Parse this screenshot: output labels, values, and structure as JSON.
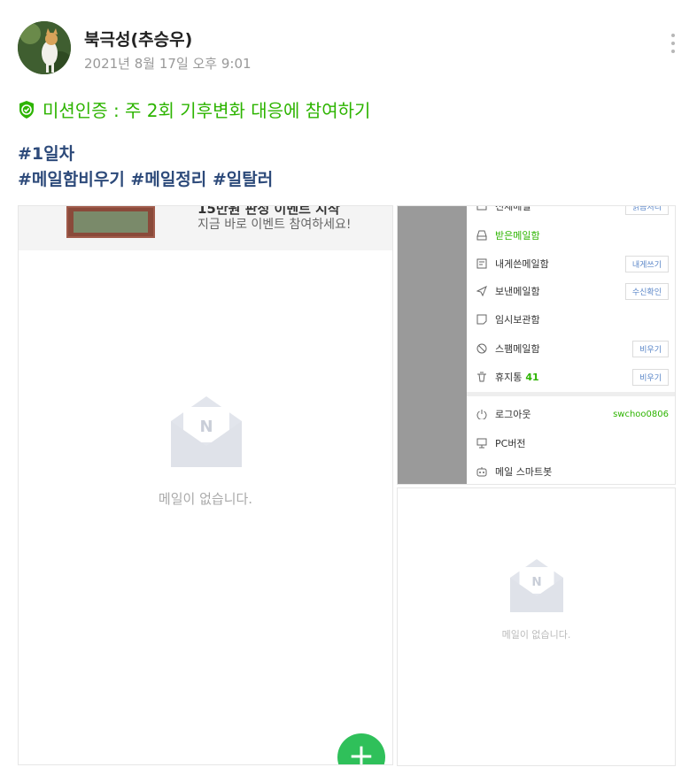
{
  "post": {
    "author": "북극성(추승우)",
    "timestamp": "2021년 8월 17일 오후 9:01",
    "mission": "미션인증 : 주 2회 기후변화 대응에 참여하기",
    "tags_line1": "#1일차",
    "tags_line2": "#메일함비우기 #메일정리 #일탈러"
  },
  "left_screenshot": {
    "banner_title": "15만원 판정 이벤트 시작",
    "banner_sub": "지금 바로 이벤트 참여하세요!",
    "empty_text": "메일이 없습니다.",
    "fab_label": "+"
  },
  "right_menu": {
    "items": [
      {
        "label": "전체메일",
        "button": "읽음처리",
        "icon": "mail-icon"
      },
      {
        "label": "받은메일함",
        "icon": "inbox-icon"
      },
      {
        "label": "내게쓴메일함",
        "button": "내게쓰기",
        "icon": "memo-icon"
      },
      {
        "label": "보낸메일함",
        "button": "수신확인",
        "icon": "send-icon"
      },
      {
        "label": "임시보관함",
        "icon": "draft-icon"
      },
      {
        "label": "스팸메일함",
        "button": "비우기",
        "icon": "spam-icon"
      },
      {
        "label": "휴지통",
        "count": "41",
        "button": "비우기",
        "icon": "trash-icon"
      },
      {
        "label": "로그아웃",
        "user": "swchoo0806",
        "icon": "power-icon"
      },
      {
        "label": "PC버전",
        "icon": "monitor-icon"
      },
      {
        "label": "메일 스마트봇",
        "icon": "bot-icon"
      }
    ]
  },
  "right_bottom": {
    "empty_text": "메일이 없습니다."
  },
  "colors": {
    "accent_green": "#2db400",
    "tag_blue": "#2d4a7a",
    "fab_green": "#2fc05a"
  }
}
